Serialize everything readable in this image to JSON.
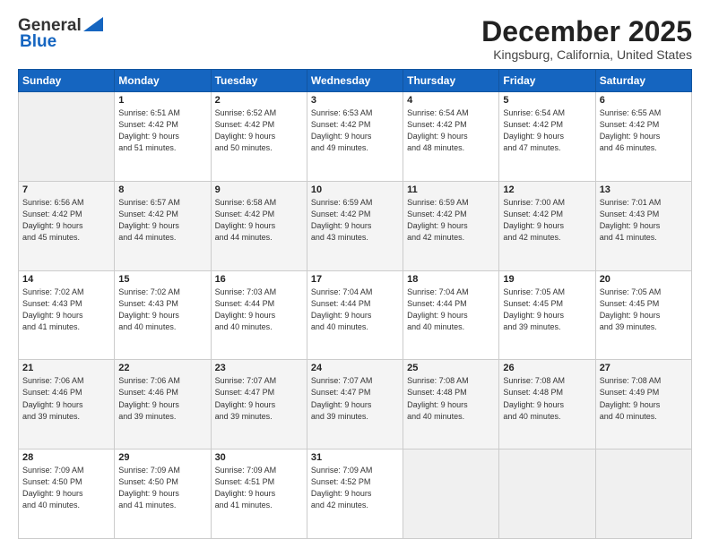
{
  "header": {
    "logo_line1": "General",
    "logo_line2": "Blue",
    "month": "December 2025",
    "location": "Kingsburg, California, United States"
  },
  "days_of_week": [
    "Sunday",
    "Monday",
    "Tuesday",
    "Wednesday",
    "Thursday",
    "Friday",
    "Saturday"
  ],
  "weeks": [
    [
      {
        "day": "",
        "info": ""
      },
      {
        "day": "1",
        "info": "Sunrise: 6:51 AM\nSunset: 4:42 PM\nDaylight: 9 hours\nand 51 minutes."
      },
      {
        "day": "2",
        "info": "Sunrise: 6:52 AM\nSunset: 4:42 PM\nDaylight: 9 hours\nand 50 minutes."
      },
      {
        "day": "3",
        "info": "Sunrise: 6:53 AM\nSunset: 4:42 PM\nDaylight: 9 hours\nand 49 minutes."
      },
      {
        "day": "4",
        "info": "Sunrise: 6:54 AM\nSunset: 4:42 PM\nDaylight: 9 hours\nand 48 minutes."
      },
      {
        "day": "5",
        "info": "Sunrise: 6:54 AM\nSunset: 4:42 PM\nDaylight: 9 hours\nand 47 minutes."
      },
      {
        "day": "6",
        "info": "Sunrise: 6:55 AM\nSunset: 4:42 PM\nDaylight: 9 hours\nand 46 minutes."
      }
    ],
    [
      {
        "day": "7",
        "info": "Sunrise: 6:56 AM\nSunset: 4:42 PM\nDaylight: 9 hours\nand 45 minutes."
      },
      {
        "day": "8",
        "info": "Sunrise: 6:57 AM\nSunset: 4:42 PM\nDaylight: 9 hours\nand 44 minutes."
      },
      {
        "day": "9",
        "info": "Sunrise: 6:58 AM\nSunset: 4:42 PM\nDaylight: 9 hours\nand 44 minutes."
      },
      {
        "day": "10",
        "info": "Sunrise: 6:59 AM\nSunset: 4:42 PM\nDaylight: 9 hours\nand 43 minutes."
      },
      {
        "day": "11",
        "info": "Sunrise: 6:59 AM\nSunset: 4:42 PM\nDaylight: 9 hours\nand 42 minutes."
      },
      {
        "day": "12",
        "info": "Sunrise: 7:00 AM\nSunset: 4:42 PM\nDaylight: 9 hours\nand 42 minutes."
      },
      {
        "day": "13",
        "info": "Sunrise: 7:01 AM\nSunset: 4:43 PM\nDaylight: 9 hours\nand 41 minutes."
      }
    ],
    [
      {
        "day": "14",
        "info": "Sunrise: 7:02 AM\nSunset: 4:43 PM\nDaylight: 9 hours\nand 41 minutes."
      },
      {
        "day": "15",
        "info": "Sunrise: 7:02 AM\nSunset: 4:43 PM\nDaylight: 9 hours\nand 40 minutes."
      },
      {
        "day": "16",
        "info": "Sunrise: 7:03 AM\nSunset: 4:44 PM\nDaylight: 9 hours\nand 40 minutes."
      },
      {
        "day": "17",
        "info": "Sunrise: 7:04 AM\nSunset: 4:44 PM\nDaylight: 9 hours\nand 40 minutes."
      },
      {
        "day": "18",
        "info": "Sunrise: 7:04 AM\nSunset: 4:44 PM\nDaylight: 9 hours\nand 40 minutes."
      },
      {
        "day": "19",
        "info": "Sunrise: 7:05 AM\nSunset: 4:45 PM\nDaylight: 9 hours\nand 39 minutes."
      },
      {
        "day": "20",
        "info": "Sunrise: 7:05 AM\nSunset: 4:45 PM\nDaylight: 9 hours\nand 39 minutes."
      }
    ],
    [
      {
        "day": "21",
        "info": "Sunrise: 7:06 AM\nSunset: 4:46 PM\nDaylight: 9 hours\nand 39 minutes."
      },
      {
        "day": "22",
        "info": "Sunrise: 7:06 AM\nSunset: 4:46 PM\nDaylight: 9 hours\nand 39 minutes."
      },
      {
        "day": "23",
        "info": "Sunrise: 7:07 AM\nSunset: 4:47 PM\nDaylight: 9 hours\nand 39 minutes."
      },
      {
        "day": "24",
        "info": "Sunrise: 7:07 AM\nSunset: 4:47 PM\nDaylight: 9 hours\nand 39 minutes."
      },
      {
        "day": "25",
        "info": "Sunrise: 7:08 AM\nSunset: 4:48 PM\nDaylight: 9 hours\nand 40 minutes."
      },
      {
        "day": "26",
        "info": "Sunrise: 7:08 AM\nSunset: 4:48 PM\nDaylight: 9 hours\nand 40 minutes."
      },
      {
        "day": "27",
        "info": "Sunrise: 7:08 AM\nSunset: 4:49 PM\nDaylight: 9 hours\nand 40 minutes."
      }
    ],
    [
      {
        "day": "28",
        "info": "Sunrise: 7:09 AM\nSunset: 4:50 PM\nDaylight: 9 hours\nand 40 minutes."
      },
      {
        "day": "29",
        "info": "Sunrise: 7:09 AM\nSunset: 4:50 PM\nDaylight: 9 hours\nand 41 minutes."
      },
      {
        "day": "30",
        "info": "Sunrise: 7:09 AM\nSunset: 4:51 PM\nDaylight: 9 hours\nand 41 minutes."
      },
      {
        "day": "31",
        "info": "Sunrise: 7:09 AM\nSunset: 4:52 PM\nDaylight: 9 hours\nand 42 minutes."
      },
      {
        "day": "",
        "info": ""
      },
      {
        "day": "",
        "info": ""
      },
      {
        "day": "",
        "info": ""
      }
    ]
  ]
}
